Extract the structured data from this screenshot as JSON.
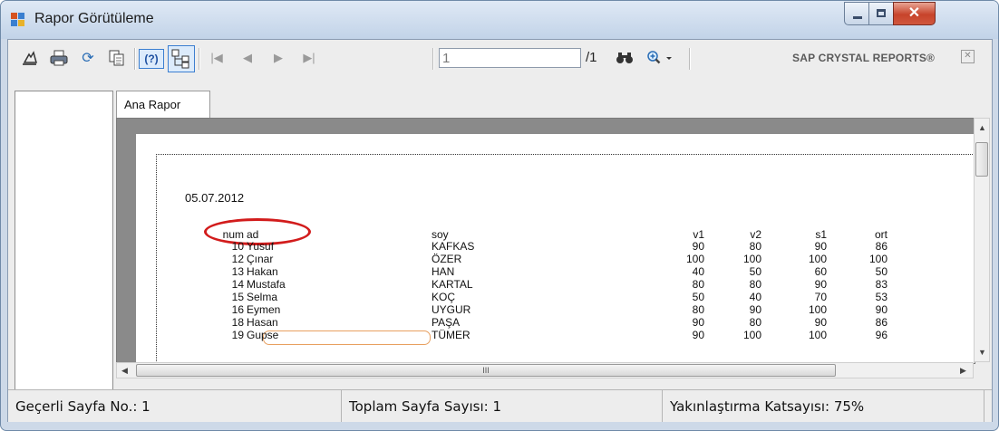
{
  "window": {
    "title": "Rapor Görütüleme"
  },
  "toolbar": {
    "page_input": "1",
    "page_total": "/1",
    "brand": "SAP CRYSTAL REPORTS®",
    "icons": [
      "export-icon",
      "print-icon",
      "refresh-icon",
      "copy-icon",
      "help-icon",
      "group-tree-icon",
      "first-page-icon",
      "previous-page-icon",
      "next-page-icon",
      "last-page-icon",
      "find-icon",
      "zoom-icon"
    ]
  },
  "tabs": [
    {
      "label": "Ana Rapor"
    }
  ],
  "report": {
    "date": "05.07.2012",
    "headers": {
      "num": "num",
      "ad": "ad",
      "soy": "soy",
      "v1": "v1",
      "v2": "v2",
      "s1": "s1",
      "ort": "ort"
    },
    "rows": [
      {
        "num": "10",
        "ad": "Yusuf",
        "soy": "KAFKAS",
        "v1": "90",
        "v2": "80",
        "s1": "90",
        "ort": "86"
      },
      {
        "num": "12",
        "ad": "Çınar",
        "soy": "ÖZER",
        "v1": "100",
        "v2": "100",
        "s1": "100",
        "ort": "100"
      },
      {
        "num": "13",
        "ad": "Hakan",
        "soy": "HAN",
        "v1": "40",
        "v2": "50",
        "s1": "60",
        "ort": "50"
      },
      {
        "num": "14",
        "ad": "Mustafa",
        "soy": "KARTAL",
        "v1": "80",
        "v2": "80",
        "s1": "90",
        "ort": "83"
      },
      {
        "num": "15",
        "ad": "Selma",
        "soy": "KOÇ",
        "v1": "50",
        "v2": "40",
        "s1": "70",
        "ort": "53"
      },
      {
        "num": "16",
        "ad": "Eymen",
        "soy": "UYGUR",
        "v1": "80",
        "v2": "90",
        "s1": "100",
        "ort": "90"
      },
      {
        "num": "18",
        "ad": "Hasan",
        "soy": "PAŞA",
        "v1": "90",
        "v2": "80",
        "s1": "90",
        "ort": "86"
      },
      {
        "num": "19",
        "ad": "Gupse",
        "soy": "TÜMER",
        "v1": "90",
        "v2": "100",
        "s1": "100",
        "ort": "96"
      }
    ]
  },
  "statusbar": {
    "current_page": "Geçerli Sayfa No.: 1",
    "total_pages": "Toplam Sayfa Sayısı: 1",
    "zoom": "Yakınlaştırma Katsayısı: 75%"
  },
  "colors": {
    "annotation": "#d21c1c",
    "titlebar": "#c2d3e8"
  }
}
